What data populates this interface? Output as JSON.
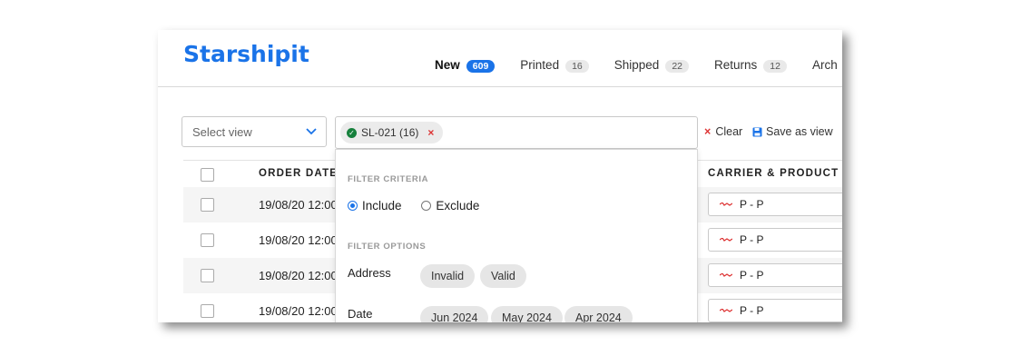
{
  "brand": {
    "name": "Starshipit",
    "color": "#1a73e8"
  },
  "tabs": [
    {
      "label": "New",
      "count": "609",
      "active": true
    },
    {
      "label": "Printed",
      "count": "16"
    },
    {
      "label": "Shipped",
      "count": "22"
    },
    {
      "label": "Returns",
      "count": "12"
    },
    {
      "label": "Arch"
    }
  ],
  "toolbar": {
    "select_view_placeholder": "Select view",
    "filter_chip_label": "SL-021 (16)",
    "clear_label": "Clear",
    "save_view_label": "Save as view"
  },
  "table": {
    "headers": {
      "order_date": "ORDER DATE",
      "carrier_product": "CARRIER & PRODUCT"
    },
    "rows": [
      {
        "date": "19/08/20 12:00",
        "carrier": "P - P"
      },
      {
        "date": "19/08/20 12:00",
        "carrier": "P - P"
      },
      {
        "date": "19/08/20 12:00",
        "carrier": "P - P"
      },
      {
        "date": "19/08/20 12:00",
        "carrier": "P - P"
      }
    ]
  },
  "filter_dropdown": {
    "criteria_title": "FILTER CRITERIA",
    "include_label": "Include",
    "exclude_label": "Exclude",
    "options_title": "FILTER OPTIONS",
    "address_label": "Address",
    "address_options": [
      "Invalid",
      "Valid"
    ],
    "date_label": "Date",
    "date_options": [
      "Jun 2024",
      "May 2024",
      "Apr 2024"
    ]
  }
}
